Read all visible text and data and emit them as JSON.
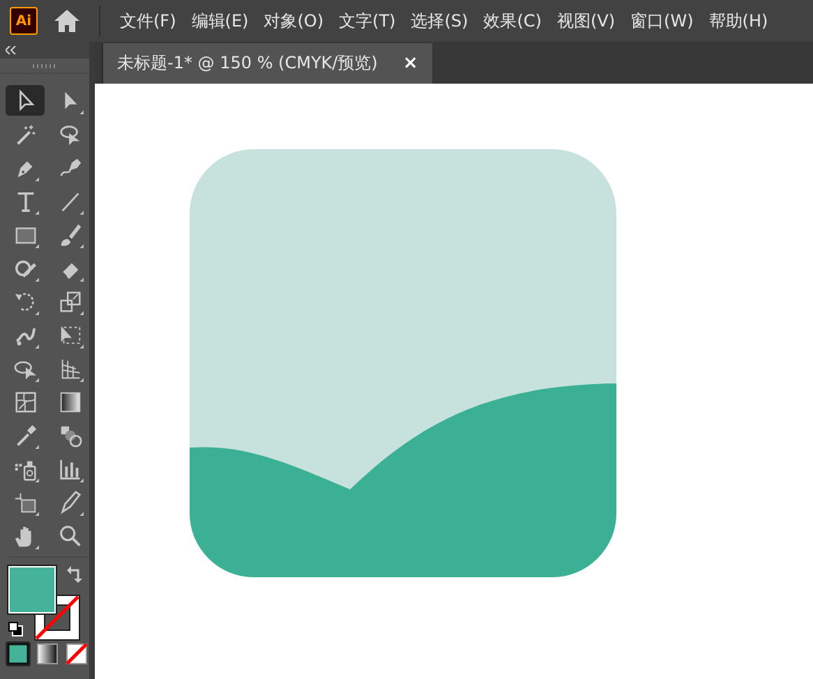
{
  "app_logo": "Ai",
  "menu": [
    "文件(F)",
    "编辑(E)",
    "对象(O)",
    "文字(T)",
    "选择(S)",
    "效果(C)",
    "视图(V)",
    "窗口(W)",
    "帮助(H)"
  ],
  "document_tab": {
    "title": "未标题-1* @ 150 % (CMYK/预览)",
    "close": "×",
    "selected": true
  },
  "tools": [
    {
      "kind": "select",
      "selected": true,
      "flyout": false
    },
    {
      "kind": "direct",
      "selected": false,
      "flyout": true
    },
    {
      "kind": "wand",
      "selected": false,
      "flyout": false
    },
    {
      "kind": "lasso",
      "selected": false,
      "flyout": false
    },
    {
      "kind": "pen",
      "selected": false,
      "flyout": true
    },
    {
      "kind": "curvature",
      "selected": false,
      "flyout": false
    },
    {
      "kind": "type",
      "selected": false,
      "flyout": true
    },
    {
      "kind": "line",
      "selected": false,
      "flyout": true
    },
    {
      "kind": "rect",
      "selected": false,
      "flyout": true
    },
    {
      "kind": "brush",
      "selected": false,
      "flyout": true
    },
    {
      "kind": "shaper",
      "selected": false,
      "flyout": true
    },
    {
      "kind": "eraser",
      "selected": false,
      "flyout": true
    },
    {
      "kind": "rotate",
      "selected": false,
      "flyout": true
    },
    {
      "kind": "scale",
      "selected": false,
      "flyout": true
    },
    {
      "kind": "puppet",
      "selected": false,
      "flyout": true
    },
    {
      "kind": "transform",
      "selected": false,
      "flyout": true
    },
    {
      "kind": "builder",
      "selected": false,
      "flyout": true
    },
    {
      "kind": "perspective",
      "selected": false,
      "flyout": true
    },
    {
      "kind": "mesh",
      "selected": false,
      "flyout": false
    },
    {
      "kind": "gradient",
      "selected": false,
      "flyout": false
    },
    {
      "kind": "eyedropper",
      "selected": false,
      "flyout": true
    },
    {
      "kind": "blend",
      "selected": false,
      "flyout": false
    },
    {
      "kind": "symbol",
      "selected": false,
      "flyout": true
    },
    {
      "kind": "graph",
      "selected": false,
      "flyout": true
    },
    {
      "kind": "artboard",
      "selected": false,
      "flyout": true
    },
    {
      "kind": "slice",
      "selected": false,
      "flyout": true
    },
    {
      "kind": "hand",
      "selected": false,
      "flyout": true
    },
    {
      "kind": "zoom",
      "selected": false,
      "flyout": false
    }
  ],
  "fill": {
    "color": "#45b39a"
  },
  "modes": [
    {
      "kind": "color",
      "selected": true
    },
    {
      "kind": "gradient",
      "selected": false
    },
    {
      "kind": "none",
      "selected": false
    }
  ]
}
